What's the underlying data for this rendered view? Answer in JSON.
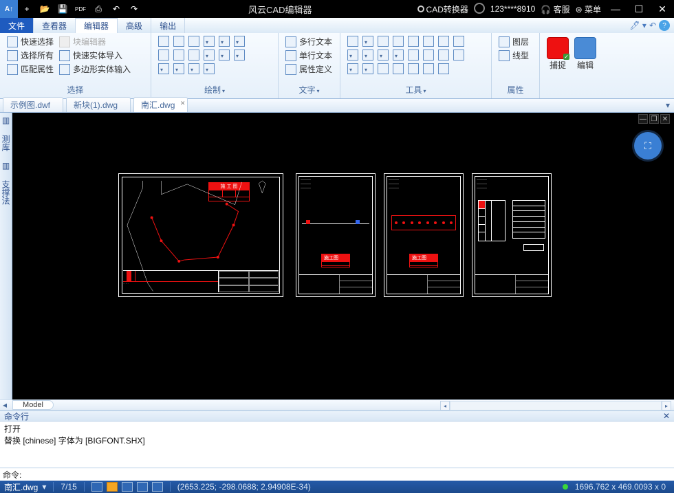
{
  "titlebar": {
    "app_title": "风云CAD编辑器",
    "converter": "CAD转换器",
    "user": "123****8910",
    "support": "客服",
    "menu": "菜单",
    "icons": {
      "new": "+",
      "open": "📂",
      "save": "💾",
      "pdf": "PDF",
      "print": "⎙",
      "undo": "↶",
      "redo": "↷"
    }
  },
  "menubar": {
    "file": "文件",
    "viewer": "查看器",
    "editor": "编辑器",
    "adv": "高级",
    "output": "输出"
  },
  "ribbon": {
    "select": {
      "quick": "快速选择",
      "all": "选择所有",
      "match": "匹配属性",
      "label": "选择",
      "blockedit": "块编辑器",
      "fastimport": "快速实体导入",
      "polyimport": "多边形实体输入"
    },
    "draw_label": "绘制",
    "text_label": "文字",
    "tools_label": "工具",
    "prop_label": "属性",
    "text": {
      "mtext": "多行文本",
      "stext": "单行文本",
      "attdef": "属性定义"
    },
    "prop": {
      "layer": "图层",
      "ltype": "线型"
    },
    "snap": "捕捉",
    "edit": "编辑"
  },
  "tabs": {
    "t1": "示例图.dwf",
    "t2": "新块(1).dwg",
    "t3": "南汇.dwg"
  },
  "left_panel": {
    "lib": "测库",
    "support": "支撑法"
  },
  "model_tab": "Model",
  "cmd": {
    "title": "命令行",
    "line1": "打开",
    "line2": "替换 [chinese] 字体为 [BIGFONT.SHX]",
    "prompt": "命令:"
  },
  "statusbar": {
    "file": "南汇.dwg",
    "page": "7/15",
    "coords": "(2653.225; -298.0688; 2.94908E-34)",
    "dims": "1696.762 x 469.0093 x 0"
  }
}
